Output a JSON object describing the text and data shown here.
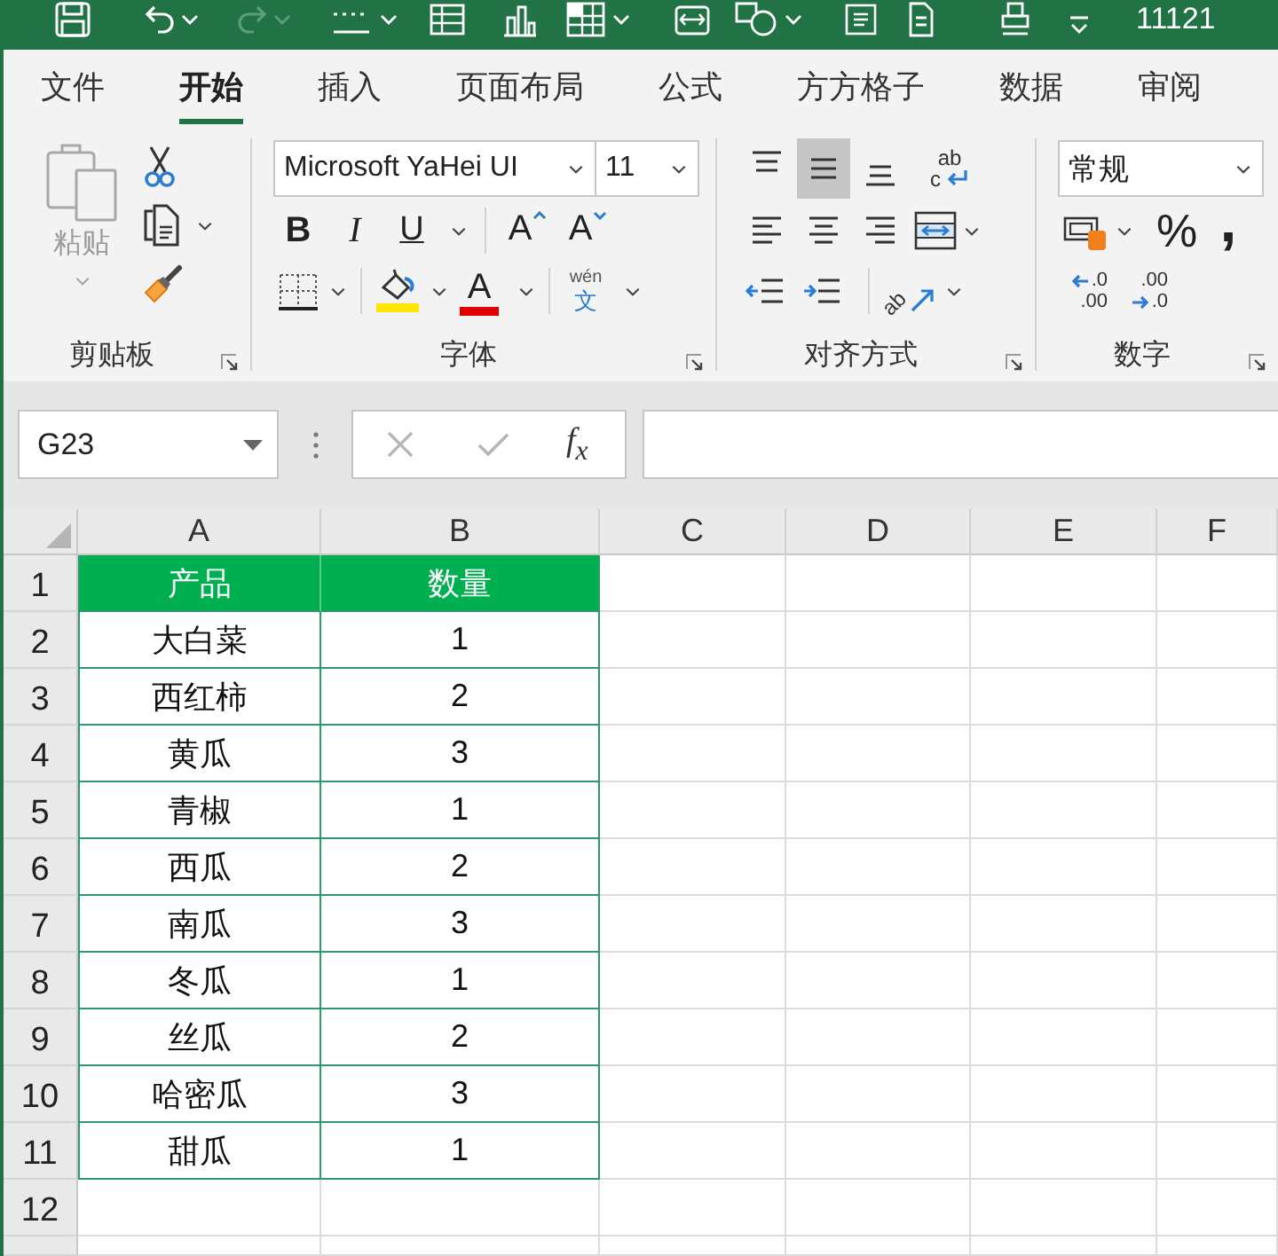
{
  "title_bar": {
    "text": "11121",
    "redo_disabled": true
  },
  "tabs": [
    {
      "label": "文件",
      "selected": false
    },
    {
      "label": "开始",
      "selected": true
    },
    {
      "label": "插入",
      "selected": false
    },
    {
      "label": "页面布局",
      "selected": false
    },
    {
      "label": "公式",
      "selected": false
    },
    {
      "label": "方方格子",
      "selected": false
    },
    {
      "label": "数据",
      "selected": false
    },
    {
      "label": "审阅",
      "selected": false
    }
  ],
  "clipboard": {
    "paste_label": "粘贴",
    "paste_disabled": true,
    "group_label": "剪贴板"
  },
  "font": {
    "name": "Microsoft YaHei UI",
    "size": "11",
    "bold": "B",
    "italic": "I",
    "underline": "U",
    "grow": "A",
    "shrink": "A",
    "font_color": "A",
    "phonetic_top": "wén",
    "phonetic_bottom": "文",
    "group_label": "字体"
  },
  "alignment": {
    "vertical": [
      {
        "kind": "top",
        "selected": false
      },
      {
        "kind": "middle",
        "selected": true
      },
      {
        "kind": "bottom",
        "selected": false
      }
    ],
    "wrap_top": "ab",
    "wrap_bottom": "c",
    "horizontal": [
      {
        "kind": "left",
        "selected": false
      },
      {
        "kind": "center",
        "selected": false
      },
      {
        "kind": "right",
        "selected": false
      }
    ],
    "orientation": "ab",
    "group_label": "对齐方式"
  },
  "number": {
    "format": "常规",
    "percent": "%",
    "comma": ",",
    "increase_top": ".0",
    "increase_bottom": ".00",
    "decrease_top": ".00",
    "decrease_bottom": ".0",
    "group_label": "数字"
  },
  "formula_bar": {
    "name_box": "G23",
    "buttons_disabled": true,
    "function_label": "f$_{x}$"
  },
  "sheet": {
    "columns": [
      "A",
      "B",
      "C",
      "D",
      "E",
      "F"
    ],
    "rows": [
      {
        "number": "1",
        "kind": "header",
        "cells": [
          "产品",
          "数量"
        ]
      },
      {
        "number": "2",
        "kind": "data",
        "cells": [
          "大白菜",
          "1"
        ]
      },
      {
        "number": "3",
        "kind": "data",
        "cells": [
          "西红柿",
          "2"
        ]
      },
      {
        "number": "4",
        "kind": "data",
        "cells": [
          "黄瓜",
          "3"
        ]
      },
      {
        "number": "5",
        "kind": "data",
        "cells": [
          "青椒",
          "1"
        ]
      },
      {
        "number": "6",
        "kind": "data",
        "cells": [
          "西瓜",
          "2"
        ]
      },
      {
        "number": "7",
        "kind": "data",
        "cells": [
          "南瓜",
          "3"
        ]
      },
      {
        "number": "8",
        "kind": "data",
        "cells": [
          "冬瓜",
          "1"
        ]
      },
      {
        "number": "9",
        "kind": "data",
        "cells": [
          "丝瓜",
          "2"
        ]
      },
      {
        "number": "10",
        "kind": "data",
        "cells": [
          "哈密瓜",
          "3"
        ]
      },
      {
        "number": "11",
        "kind": "data",
        "cells": [
          "甜瓜",
          "1"
        ]
      },
      {
        "number": "12",
        "kind": "empty"
      }
    ]
  }
}
